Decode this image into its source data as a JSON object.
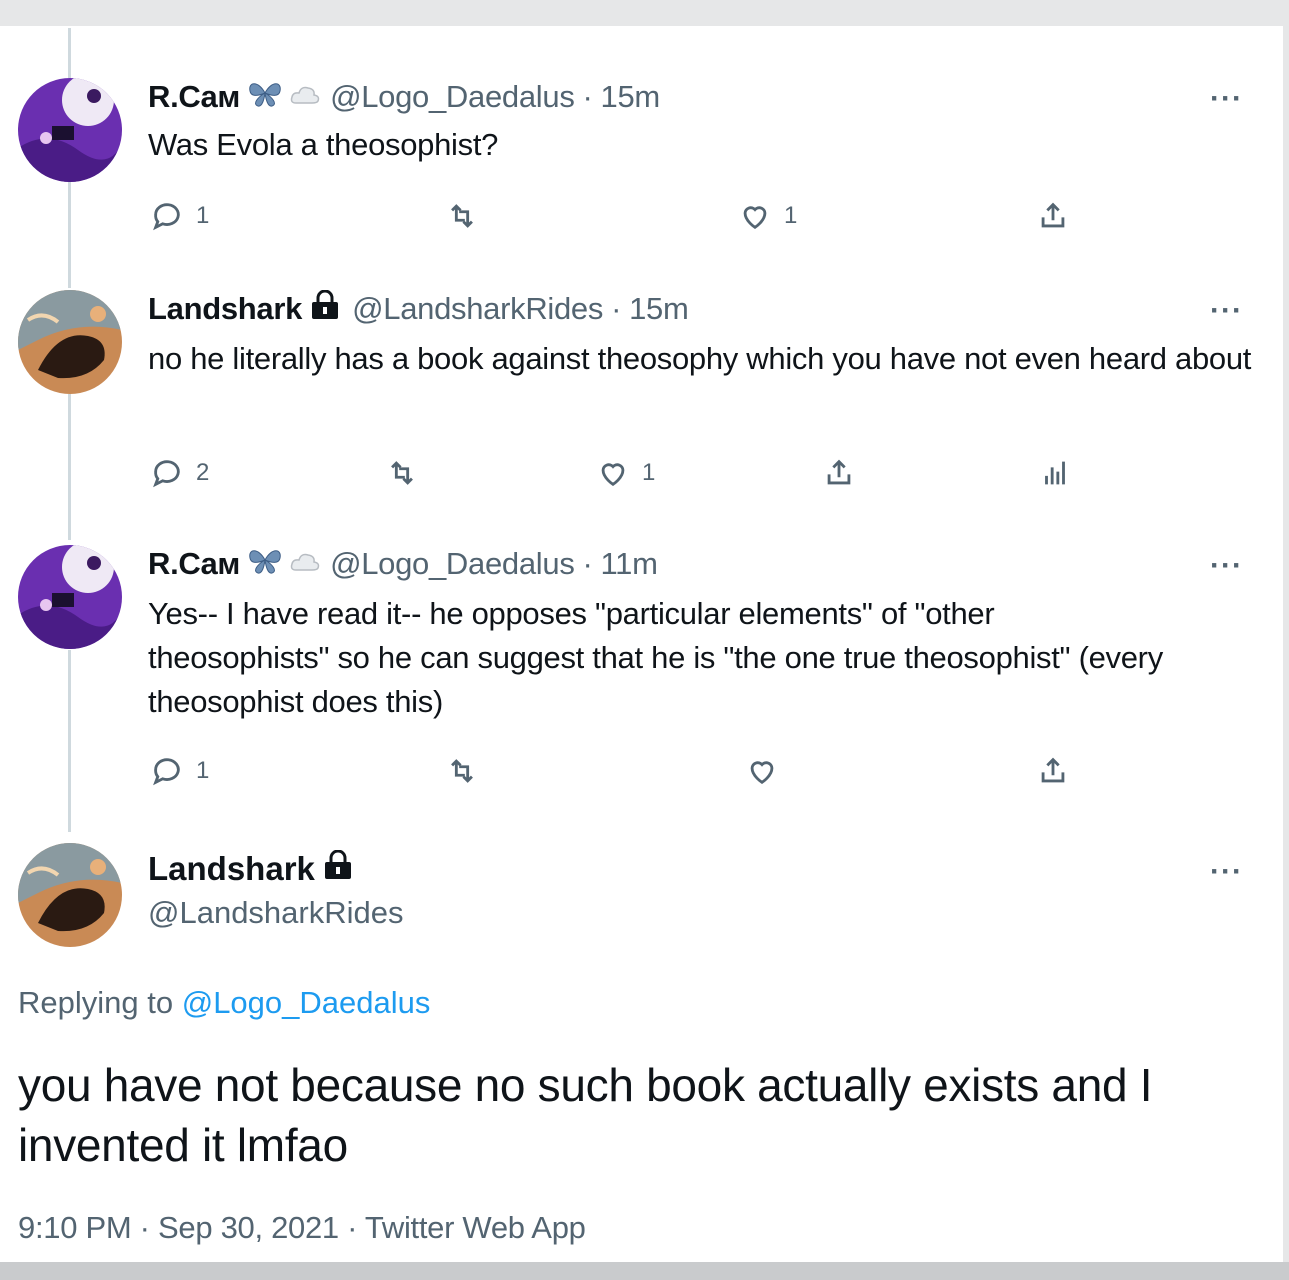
{
  "thread": [
    {
      "name": "R.Cам",
      "handle": "@Logo_Daedalus",
      "sep": "·",
      "time": "15m",
      "text": "Was Evola a theosophist?",
      "more": "···",
      "replies": "1",
      "retweets": "",
      "likes": "1"
    },
    {
      "name": "Landshark",
      "handle": "@LandsharkRides",
      "sep": "·",
      "time": "15m",
      "text": "no he literally has a book against theosophy which you have not even heard about",
      "more": "···",
      "replies": "2",
      "retweets": "",
      "likes": "1"
    },
    {
      "name": "R.Cам",
      "handle": "@Logo_Daedalus",
      "sep": "·",
      "time": "11m",
      "text": "Yes-- I have read it-- he opposes \"particular elements\" of \"other theosophists\" so he can suggest that he is \"the one true theosophist\" (every theosophist does this)",
      "more": "···",
      "replies": "1",
      "retweets": "",
      "likes": ""
    }
  ],
  "main_tweet": {
    "name": "Landshark",
    "handle": "@LandsharkRides",
    "more": "···",
    "replying_prefix": "Replying to",
    "replying_to": "@Logo_Daedalus",
    "text": "you have not because no such book actually exists and I invented it lmfao",
    "meta": "9:10 PM · Sep 30, 2021 · Twitter Web App"
  },
  "colors": {
    "text": "#0f1419",
    "secondary": "#536471",
    "link": "#1d9bf0",
    "thread_line": "#cfd9de",
    "rcam_avatar": "#6a2fb0",
    "landshark_avatar": "#c98a55"
  },
  "icons": {
    "reply": "speech-bubble",
    "retweet": "two-arrows-loop",
    "like": "heart",
    "share": "upload-arrow",
    "analytics": "bar-chart",
    "lock": "padlock",
    "butterfly": "butterfly-emoji",
    "cloud": "cloud-emoji"
  }
}
